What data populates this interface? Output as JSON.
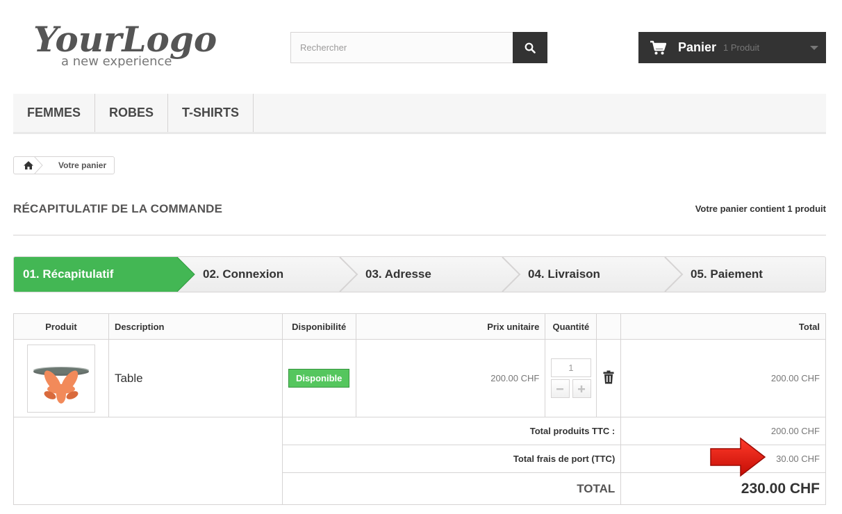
{
  "header": {
    "logo": {
      "main": "YourLogo",
      "tagline": "a new experience"
    },
    "search": {
      "placeholder": "Rechercher"
    },
    "cart": {
      "title": "Panier",
      "count_label": "1 Produit"
    }
  },
  "menu": {
    "items": [
      {
        "label": "FEMMES"
      },
      {
        "label": "ROBES"
      },
      {
        "label": "T-SHIRTS"
      }
    ]
  },
  "breadcrumb": {
    "current": "Votre panier"
  },
  "page": {
    "heading": "RÉCAPITULATIF DE LA COMMANDE",
    "counter": "Votre panier contient 1 produit"
  },
  "steps": [
    {
      "label": "01. Récapitulatif"
    },
    {
      "label": "02. Connexion"
    },
    {
      "label": "03. Adresse"
    },
    {
      "label": "04. Livraison"
    },
    {
      "label": "05. Paiement"
    }
  ],
  "table": {
    "headers": {
      "product": "Produit",
      "description": "Description",
      "availability": "Disponibilité",
      "unit_price": "Prix unitaire",
      "quantity": "Quantité",
      "total": "Total"
    },
    "item": {
      "description": "Table",
      "availability": "Disponible",
      "unit_price": "200.00 CHF",
      "quantity": "1",
      "total": "200.00 CHF"
    },
    "summary": {
      "products_label": "Total produits TTC :",
      "products_value": "200.00 CHF",
      "shipping_label": "Total frais de port (TTC)",
      "shipping_value": "30.00 CHF",
      "total_label": "TOTAL",
      "total_value": "230.00 CHF"
    }
  },
  "colors": {
    "accent_green": "#43b754",
    "dark": "#333333",
    "arrow_red": "#e21b12"
  },
  "icons": {
    "search": "search-icon",
    "cart": "cart-icon",
    "home": "home-icon",
    "delete": "trash-icon",
    "annotation": "red-arrow-icon"
  }
}
